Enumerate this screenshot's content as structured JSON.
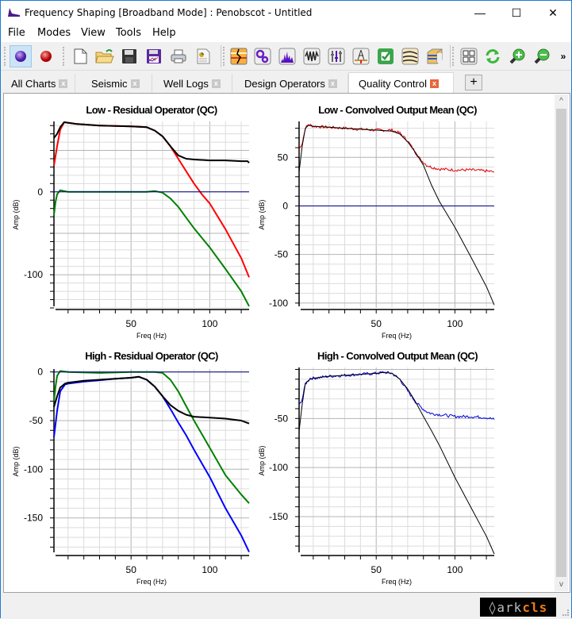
{
  "window": {
    "title": "Frequency Shaping [Broadband Mode] : Penobscot - Untitled",
    "controls": {
      "minimize": "—",
      "maximize": "☐",
      "close": "✕"
    }
  },
  "menu": [
    "File",
    "Modes",
    "View",
    "Tools",
    "Help"
  ],
  "toolbar": {
    "groups": [
      [
        "mode-broadband-icon",
        "mode-record-icon"
      ],
      [
        "new-file-icon",
        "open-folder-icon",
        "save-icon",
        "save-chart-icon",
        "print-icon",
        "report-icon"
      ],
      [
        "seismic-section-icon",
        "settings-gears-icon",
        "spectrum-icon",
        "wavelet-icon",
        "equalizer-icon",
        "well-icon",
        "quality-check-icon",
        "horizons-icon",
        "seismic-cube-icon"
      ],
      [
        "grid-layout-icon",
        "refresh-icon",
        "zoom-in-icon",
        "zoom-out-icon"
      ]
    ],
    "overflow": "»"
  },
  "tabs": [
    {
      "label": "All Charts",
      "active": false
    },
    {
      "label": "Seismic",
      "active": false
    },
    {
      "label": "Well Logs",
      "active": false
    },
    {
      "label": "Design Operators",
      "active": false
    },
    {
      "label": "Quality Control",
      "active": true
    }
  ],
  "tab_add": "+",
  "scrollbar": {
    "position_fraction": 0.0,
    "visible_fraction": 0.98
  },
  "footer": {
    "logo_prefix": "◊",
    "logo_ark": "ark",
    "logo_cls": "cls"
  },
  "colors": {
    "red": "#ff0000",
    "green": "#008000",
    "blue": "#0000ff",
    "black": "#000000",
    "zero_line": "#000080",
    "grid": "#dcdcdc",
    "grid_major": "#b4b4b4"
  },
  "chart_data": [
    {
      "type": "line",
      "title": "Low - Residual Operator (QC)",
      "xlabel": "Freq (Hz)",
      "ylabel": "Amp (dB)",
      "xlim": [
        0,
        125
      ],
      "ylim": [
        -140,
        85
      ],
      "xticks": [
        50,
        100
      ],
      "yticks": [
        0,
        -100
      ],
      "grid": true,
      "series": [
        {
          "name": "red",
          "color": "#ff0000",
          "width": 2,
          "x": [
            1,
            3,
            5,
            7.5,
            15,
            30,
            50,
            60,
            65,
            70,
            75,
            80,
            85,
            90,
            95,
            100,
            110,
            120,
            125
          ],
          "y": [
            32,
            55,
            75,
            84,
            82,
            80,
            79,
            78,
            74,
            67,
            55,
            40,
            25,
            10,
            -3,
            -14,
            -45,
            -80,
            -103
          ]
        },
        {
          "name": "black",
          "color": "#000000",
          "width": 2,
          "x": [
            1,
            3,
            5,
            7.5,
            15,
            30,
            50,
            60,
            65,
            70,
            75,
            80,
            85,
            90,
            100,
            110,
            120,
            124,
            125
          ],
          "y": [
            65,
            70,
            78,
            84,
            82,
            80,
            79,
            78,
            74,
            67,
            55,
            44,
            40,
            39,
            38,
            38,
            37,
            37,
            35
          ]
        },
        {
          "name": "green",
          "color": "#008000",
          "width": 2,
          "x": [
            1,
            2,
            3,
            5,
            10,
            30,
            50,
            60,
            65,
            70,
            75,
            80,
            85,
            90,
            100,
            110,
            120,
            125
          ],
          "y": [
            -28,
            -12,
            -3,
            2,
            0,
            0,
            0,
            0,
            1,
            -1,
            -8,
            -18,
            -31,
            -44,
            -67,
            -93,
            -120,
            -138
          ]
        },
        {
          "name": "zero-line",
          "color": "#000080",
          "width": 1,
          "x": [
            0,
            125
          ],
          "y": [
            0,
            0
          ]
        }
      ]
    },
    {
      "type": "line",
      "title": "Low - Convolved Output Mean (QC)",
      "xlabel": "Freq (Hz)",
      "ylabel": "Amp (dB)",
      "xlim": [
        0,
        125
      ],
      "ylim": [
        -105,
        87
      ],
      "xticks": [
        50,
        100
      ],
      "yticks": [
        50,
        0,
        -50,
        -100
      ],
      "grid": true,
      "series": [
        {
          "name": "red",
          "color": "#dd0000",
          "width": 1,
          "noisy": true,
          "x": [
            1,
            3,
            5,
            7,
            10,
            20,
            30,
            50,
            60,
            65,
            70,
            75,
            78,
            82,
            85,
            90,
            100,
            110,
            120,
            125
          ],
          "y": [
            58,
            65,
            80,
            84,
            82,
            81,
            80,
            78,
            78,
            75,
            67,
            55,
            48,
            42,
            40,
            38,
            37,
            37,
            36,
            35
          ]
        },
        {
          "name": "black",
          "color": "#000000",
          "width": 1,
          "x": [
            1,
            3,
            5,
            7,
            10,
            20,
            30,
            50,
            60,
            65,
            70,
            75,
            80,
            85,
            90,
            100,
            110,
            120,
            125
          ],
          "y": [
            35,
            62,
            80,
            83,
            82,
            81,
            80,
            78,
            77,
            74,
            66,
            55,
            42,
            22,
            5,
            -22,
            -52,
            -83,
            -102
          ]
        },
        {
          "name": "zero-line",
          "color": "#000080",
          "width": 1,
          "x": [
            0,
            125
          ],
          "y": [
            0,
            0
          ]
        }
      ]
    },
    {
      "type": "line",
      "title": "High - Residual Operator (QC)",
      "xlabel": "Freq (Hz)",
      "ylabel": "Amp (dB)",
      "xlim": [
        0,
        125
      ],
      "ylim": [
        -187,
        3
      ],
      "xticks": [
        50,
        100
      ],
      "yticks": [
        0,
        -50,
        -100,
        -150
      ],
      "grid": true,
      "series": [
        {
          "name": "green",
          "color": "#008000",
          "width": 2,
          "x": [
            1,
            2,
            3,
            5,
            10,
            30,
            50,
            60,
            65,
            70,
            75,
            80,
            85,
            90,
            100,
            110,
            120,
            125
          ],
          "y": [
            -30,
            -15,
            -4,
            1,
            0,
            -1,
            0,
            0,
            0,
            -1,
            -8,
            -20,
            -35,
            -50,
            -78,
            -106,
            -126,
            -135
          ]
        },
        {
          "name": "blue",
          "color": "#0000ff",
          "width": 2,
          "x": [
            1,
            3,
            5,
            8,
            10,
            20,
            40,
            50,
            55,
            60,
            65,
            70,
            75,
            80,
            85,
            90,
            100,
            110,
            120,
            125
          ],
          "y": [
            -67,
            -40,
            -20,
            -13,
            -12,
            -10,
            -7,
            -6,
            -5,
            -8,
            -15,
            -25,
            -38,
            -52,
            -65,
            -80,
            -108,
            -140,
            -168,
            -185
          ]
        },
        {
          "name": "black",
          "color": "#000000",
          "width": 2,
          "x": [
            1,
            3,
            5,
            8,
            10,
            20,
            40,
            50,
            55,
            60,
            65,
            70,
            75,
            80,
            85,
            90,
            100,
            110,
            120,
            125
          ],
          "y": [
            -36,
            -25,
            -16,
            -12,
            -11,
            -9,
            -7,
            -6,
            -5,
            -8,
            -15,
            -25,
            -34,
            -40,
            -44,
            -46,
            -47,
            -48,
            -50,
            -53
          ]
        },
        {
          "name": "zero-line",
          "color": "#000080",
          "width": 1,
          "x": [
            0,
            125
          ],
          "y": [
            0,
            0
          ]
        }
      ]
    },
    {
      "type": "line",
      "title": "High - Convolved Output Mean (QC)",
      "xlabel": "Freq (Hz)",
      "ylabel": "Amp (dB)",
      "xlim": [
        0,
        125
      ],
      "ylim": [
        -188,
        2
      ],
      "xticks": [
        50,
        100
      ],
      "yticks": [
        -50,
        -100,
        -150
      ],
      "grid": true,
      "series": [
        {
          "name": "blue",
          "color": "#0000dd",
          "width": 1,
          "noisy": true,
          "x": [
            1,
            3,
            5,
            8,
            10,
            20,
            40,
            50,
            55,
            60,
            65,
            70,
            75,
            78,
            82,
            85,
            90,
            100,
            110,
            120,
            125
          ],
          "y": [
            -37,
            -30,
            -15,
            -9,
            -9,
            -7,
            -5,
            -4,
            -3,
            -4,
            -10,
            -22,
            -33,
            -38,
            -43,
            -45,
            -46,
            -48,
            -48,
            -49,
            -51
          ]
        },
        {
          "name": "black",
          "color": "#000000",
          "width": 1,
          "x": [
            1,
            3,
            5,
            8,
            10,
            20,
            40,
            50,
            55,
            60,
            65,
            70,
            75,
            80,
            85,
            90,
            100,
            110,
            120,
            125
          ],
          "y": [
            -63,
            -35,
            -14,
            -10,
            -9,
            -7,
            -5,
            -4,
            -3,
            -4,
            -10,
            -20,
            -33,
            -48,
            -62,
            -77,
            -110,
            -140,
            -170,
            -188
          ]
        }
      ]
    }
  ]
}
